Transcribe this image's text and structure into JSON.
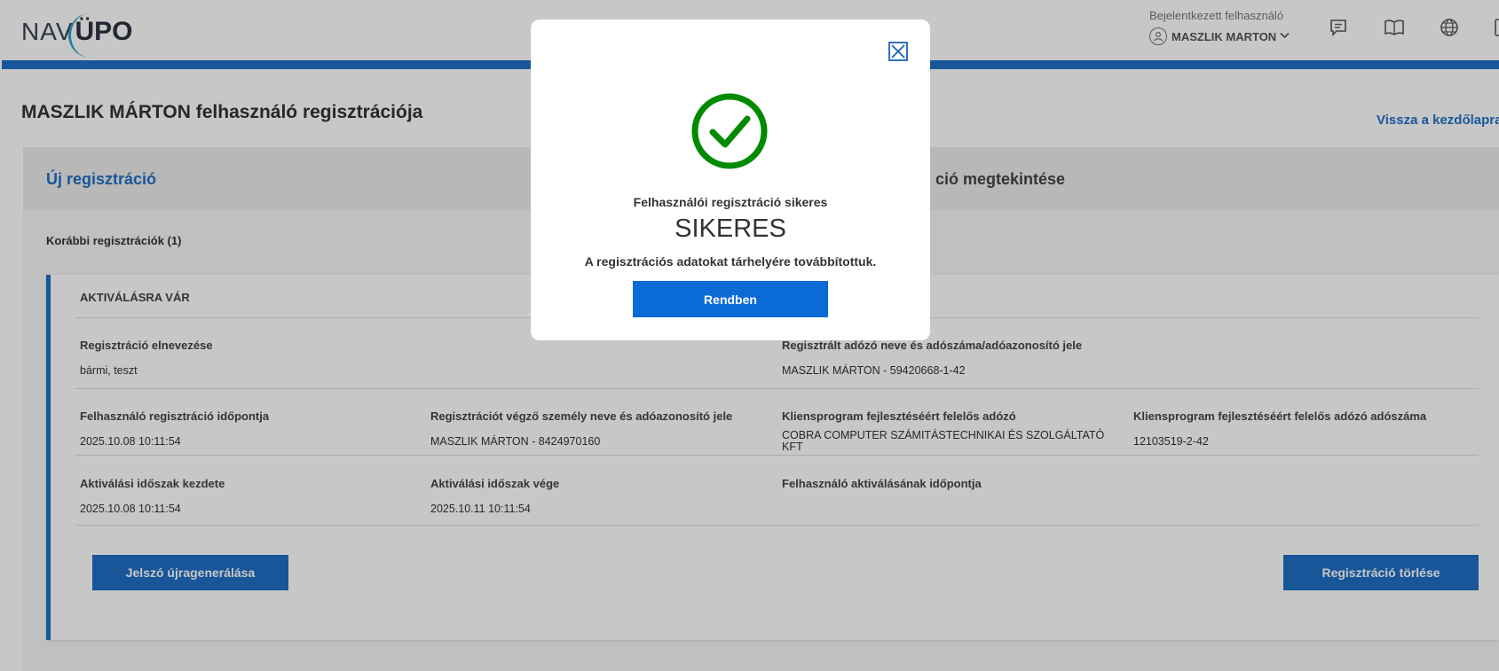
{
  "header": {
    "logo_nav": "NAV",
    "logo_upo": "ÜPO",
    "user_caption": "Bejelentkezett felhasználó",
    "user_name": "MASZLIK MARTON",
    "icons": [
      "chat-icon",
      "book-icon",
      "globe-icon"
    ]
  },
  "page": {
    "title": "MASZLIK MÁRTON felhasználó regisztrációja",
    "back_link": "Vissza a kezdőlapra"
  },
  "tabs": {
    "new": "Új regisztráció",
    "view": "ció megtekintése"
  },
  "registrations": {
    "section_title": "Korábbi regisztrációk (1)",
    "card": {
      "status": "AKTIVÁLÁSRA VÁR",
      "reg_name_label": "Regisztráció elnevezése",
      "reg_name_value": "bármi, teszt",
      "taxpayer_label": "Regisztrált adózó neve és adószáma/adóazonosító jele",
      "taxpayer_value": "MASZLIK MÁRTON - 59420668-1-42",
      "reg_time_label": "Felhasználó regisztráció időpontja",
      "reg_time_value": "2025.10.08 10:11:54",
      "registrar_label": "Regisztrációt végző személy neve és adóazonosító jele",
      "registrar_value": "MASZLIK MÁRTON - 8424970160",
      "client_dev_label": "Kliensprogram fejlesztéséért felelős adózó",
      "client_dev_value": "COBRA COMPUTER SZÁMITÁSTECHNIKAI ÉS SZOLGÁLTATÓ KFT",
      "client_tax_label": "Kliensprogram fejlesztéséért felelős adózó adószáma",
      "client_tax_value": "12103519-2-42",
      "act_start_label": "Aktiválási időszak kezdete",
      "act_start_value": "2025.10.08 10:11:54",
      "act_end_label": "Aktiválási időszak vége",
      "act_end_value": "2025.10.11 10:11:54",
      "activation_time_label": "Felhasználó aktiválásának időpontja",
      "regen_button": "Jelszó újragenerálása",
      "delete_button": "Regisztráció törlése"
    }
  },
  "modal": {
    "title": "Felhasználói regisztráció sikeres",
    "status": "SIKERES",
    "message": "A regisztrációs adatokat tárhelyére továbbítottuk.",
    "ok_button": "Rendben",
    "success_color": "#008a00",
    "button_color": "#0a6ad6"
  }
}
